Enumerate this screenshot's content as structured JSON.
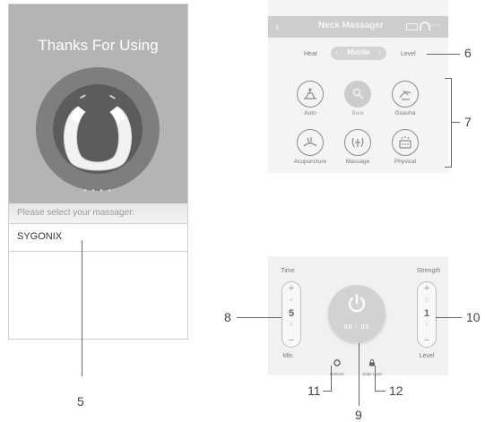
{
  "left_screen": {
    "title": "Thanks For Using",
    "select_prompt": "Please select your massager:",
    "device_name": "SYGONIX",
    "page_indicator": "• • • •"
  },
  "mode_screen": {
    "title": "Neck Massager",
    "heat_label": "Heat",
    "heat_value": "Middle",
    "level_label": "Level",
    "modes": [
      {
        "label": "Auto",
        "icon": "auto-icon",
        "active": false
      },
      {
        "label": "Beat",
        "icon": "beat-icon",
        "active": true
      },
      {
        "label": "Guasha",
        "icon": "guasha-icon",
        "active": false
      },
      {
        "label": "Acupuncture",
        "icon": "acupuncture-icon",
        "active": false
      },
      {
        "label": "Massage",
        "icon": "massage-icon",
        "active": false
      },
      {
        "label": "Physical",
        "icon": "physical-icon",
        "active": false
      }
    ]
  },
  "control_screen": {
    "time_label": "Time",
    "time_above": "4",
    "time_value": "5",
    "time_below": "6",
    "time_unit": "Min",
    "strength_label": "Strength",
    "strength_above": "0",
    "strength_value": "1",
    "strength_below": "2",
    "strength_unit": "Level",
    "timer": "00 : 00",
    "refresh_label": "Refresh",
    "lock_label": "Elder Lock"
  },
  "callouts": {
    "c5": "5",
    "c6": "6",
    "c7": "7",
    "c8": "8",
    "c9": "9",
    "c10": "10",
    "c11": "11",
    "c12": "12"
  },
  "colors": {
    "hero_gray": "#b4b4b4",
    "nav_gray": "#cdcdcd",
    "panel_bg": "#f4f4f4"
  }
}
